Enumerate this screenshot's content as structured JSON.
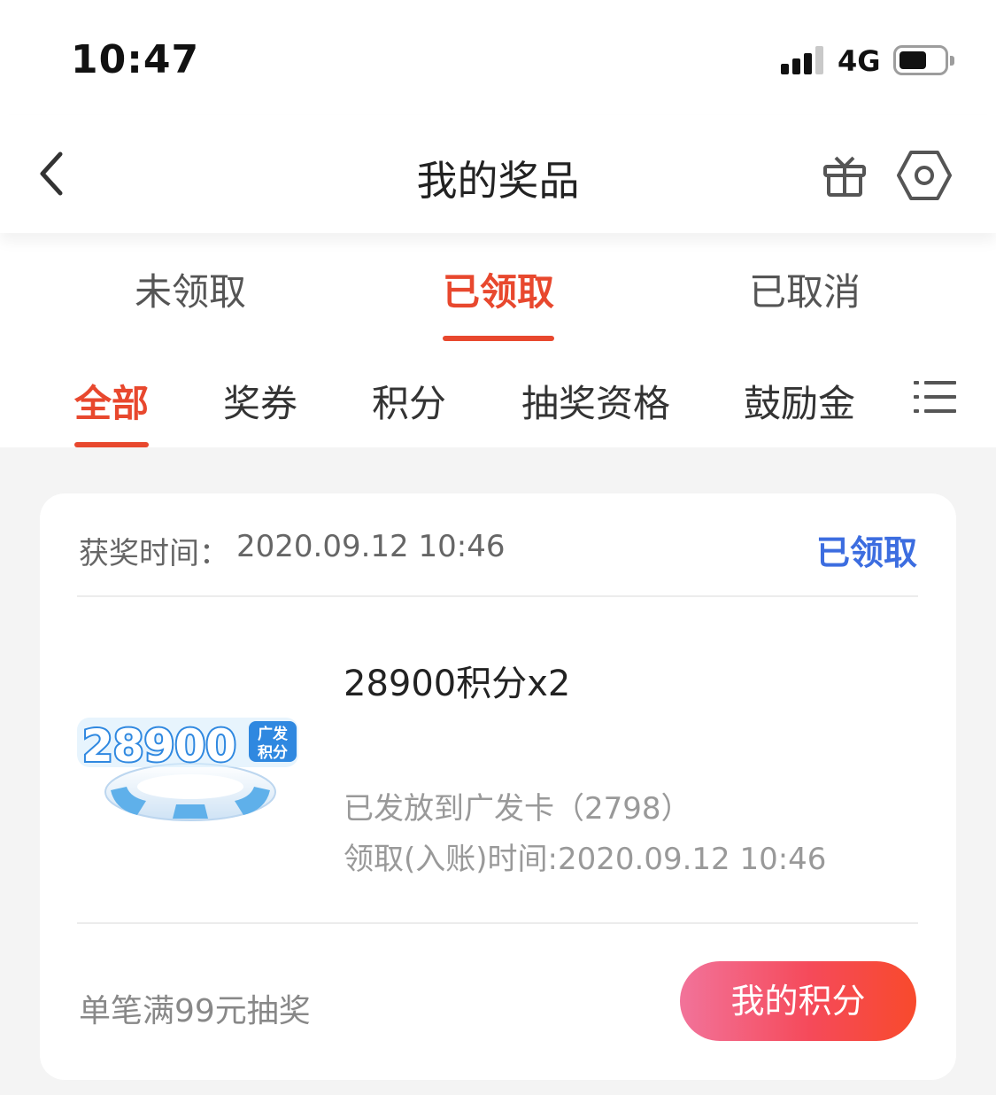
{
  "status_bar": {
    "time": "10:47",
    "network": "4G"
  },
  "nav": {
    "title": "我的奖品",
    "icons": [
      "back-icon",
      "gift-icon",
      "settings-icon"
    ]
  },
  "status_tabs": [
    {
      "label": "未领取",
      "active": false
    },
    {
      "label": "已领取",
      "active": true
    },
    {
      "label": "已取消",
      "active": false
    }
  ],
  "category_tabs": [
    {
      "label": "全部",
      "active": true
    },
    {
      "label": "奖券",
      "active": false
    },
    {
      "label": "积分",
      "active": false
    },
    {
      "label": "抽奖资格",
      "active": false
    },
    {
      "label": "鼓励金",
      "active": false
    }
  ],
  "card": {
    "win_time_label": "获奖时间：",
    "win_time": "2020.09.12 10:46",
    "status": "已领取",
    "prize_image": {
      "number": "28900",
      "caption_top": "广发",
      "caption_bottom": "积分"
    },
    "prize_name": "28900积分x2",
    "destination": "已发放到广发卡（2798）",
    "claim_time": "领取(入账)时间:2020.09.12 10:46",
    "footer_text": "单笔满99元抽奖",
    "button_label": "我的积分"
  },
  "colors": {
    "accent": "#e8482e",
    "link_blue": "#3c6de0",
    "background": "#f4f4f4"
  }
}
